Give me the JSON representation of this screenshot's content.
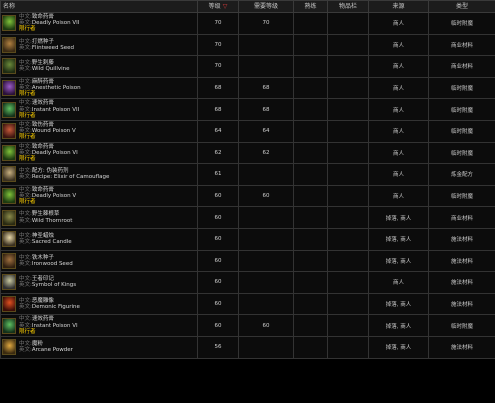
{
  "headers": {
    "name": "名称",
    "level": "等级",
    "sort_glyph": "▽",
    "req_level": "需要等级",
    "skill": "熟练",
    "slots": "物品栏",
    "source": "来源",
    "type": "类型"
  },
  "labels": {
    "cn": "中文:",
    "en": "英文:"
  },
  "rows": [
    {
      "cn": "致命药膏",
      "en": "Deadly Poison VII",
      "tag": "限行者",
      "level": "70",
      "req": "70",
      "src": "商人",
      "type": "临时附魔",
      "icon": "green-poison-vial-icon",
      "c1": "#1d3a10",
      "c2": "#7fc23a"
    },
    {
      "cn": "打燃种子",
      "en": "Flintweed Seed",
      "tag": "",
      "level": "70",
      "req": "",
      "src": "商人",
      "type": "商业材料",
      "icon": "seed-pouch-icon",
      "c1": "#3a2a14",
      "c2": "#b08040"
    },
    {
      "cn": "野生刺藤",
      "en": "Wild Quillvine",
      "tag": "",
      "level": "70",
      "req": "",
      "src": "商人",
      "type": "商业材料",
      "icon": "vine-icon",
      "c1": "#1e2a12",
      "c2": "#6a8a3a"
    },
    {
      "cn": "麻醉药膏",
      "en": "Anesthetic Poison",
      "tag": "限行者",
      "level": "68",
      "req": "68",
      "src": "商人",
      "type": "临时附魔",
      "icon": "purple-poison-vial-icon",
      "c1": "#2a1238",
      "c2": "#9a5ac8"
    },
    {
      "cn": "速效药膏",
      "en": "Instant Poison VII",
      "tag": "限行者",
      "level": "68",
      "req": "68",
      "src": "商人",
      "type": "临时附魔",
      "icon": "green-poison-vial-icon",
      "c1": "#14301a",
      "c2": "#5ec060"
    },
    {
      "cn": "致伤药膏",
      "en": "Wound Poison V",
      "tag": "限行者",
      "level": "64",
      "req": "64",
      "src": "商人",
      "type": "临时附魔",
      "icon": "red-poison-vial-icon",
      "c1": "#3a1410",
      "c2": "#c85a3a"
    },
    {
      "cn": "致命药膏",
      "en": "Deadly Poison VI",
      "tag": "限行者",
      "level": "62",
      "req": "62",
      "src": "商人",
      "type": "临时附魔",
      "icon": "green-poison-vial-icon",
      "c1": "#1d3a10",
      "c2": "#7fc23a"
    },
    {
      "cn": "配方: 伪装药剂",
      "en": "Recipe: Elixir of Camouflage",
      "tag": "",
      "level": "61",
      "req": "",
      "src": "商人",
      "type": "炼金配方",
      "icon": "recipe-scroll-icon",
      "c1": "#3a3020",
      "c2": "#c8b080"
    },
    {
      "cn": "致命药膏",
      "en": "Deadly Poison V",
      "tag": "限行者",
      "level": "60",
      "req": "60",
      "src": "商人",
      "type": "临时附魔",
      "icon": "green-poison-vial-icon",
      "c1": "#1d3a10",
      "c2": "#7fc23a"
    },
    {
      "cn": "野生棘根草",
      "en": "Wild Thornroot",
      "tag": "",
      "level": "60",
      "req": "",
      "src": "掉落, 商人",
      "type": "商业材料",
      "icon": "root-icon",
      "c1": "#2a2a12",
      "c2": "#8a8a4a"
    },
    {
      "cn": "神圣蜡烛",
      "en": "Sacred Candle",
      "tag": "",
      "level": "60",
      "req": "",
      "src": "掉落, 商人",
      "type": "施法材料",
      "icon": "candle-icon",
      "c1": "#3a3020",
      "c2": "#e8d8a8"
    },
    {
      "cn": "铁木种子",
      "en": "Ironwood Seed",
      "tag": "",
      "level": "60",
      "req": "",
      "src": "掉落, 商人",
      "type": "施法材料",
      "icon": "seed-icon",
      "c1": "#302010",
      "c2": "#a07040"
    },
    {
      "cn": "王者印记",
      "en": "Symbol of Kings",
      "tag": "",
      "level": "60",
      "req": "",
      "src": "商人",
      "type": "施法材料",
      "icon": "symbol-icon",
      "c1": "#303030",
      "c2": "#c8c8a0"
    },
    {
      "cn": "恶魔雕像",
      "en": "Demonic Figurine",
      "tag": "",
      "level": "60",
      "req": "",
      "src": "掉落, 商人",
      "type": "施法材料",
      "icon": "demon-figurine-icon",
      "c1": "#3a0e08",
      "c2": "#e05020"
    },
    {
      "cn": "速效药膏",
      "en": "Instant Poison VI",
      "tag": "限行者",
      "level": "60",
      "req": "60",
      "src": "掉落, 商人",
      "type": "临时附魔",
      "icon": "green-poison-vial-icon",
      "c1": "#14301a",
      "c2": "#5ec060"
    },
    {
      "cn": "魔粉",
      "en": "Arcane Powder",
      "tag": "",
      "level": "56",
      "req": "",
      "src": "掉落, 商人",
      "type": "施法材料",
      "icon": "powder-icon",
      "c1": "#3a2a10",
      "c2": "#e0a840"
    }
  ]
}
